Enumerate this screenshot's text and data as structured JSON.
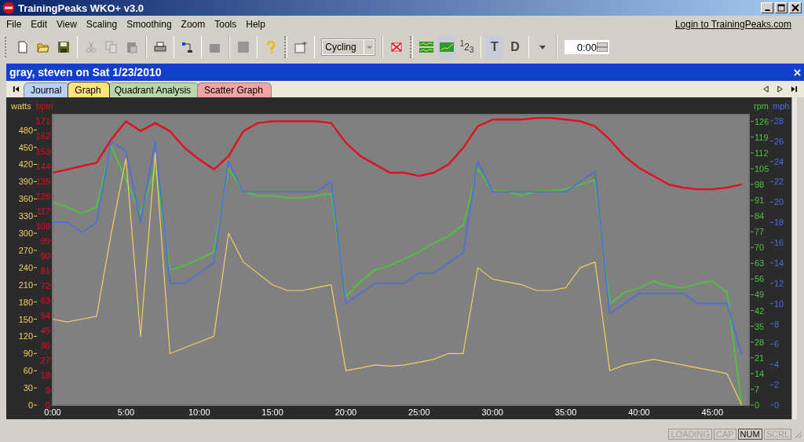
{
  "window": {
    "title": "TrainingPeaks WKO+ v3.0"
  },
  "menu": [
    "File",
    "Edit",
    "View",
    "Scaling",
    "Smoothing",
    "Zoom",
    "Tools",
    "Help"
  ],
  "login_link": "Login to TrainingPeaks.com",
  "toolbar": [
    {
      "kind": "new",
      "disabled": false
    },
    {
      "kind": "open",
      "disabled": false
    },
    {
      "kind": "save",
      "disabled": false
    },
    {
      "kind": "cut",
      "disabled": true
    },
    {
      "kind": "copy",
      "disabled": true
    },
    {
      "kind": "paste",
      "disabled": true
    },
    {
      "kind": "print",
      "disabled": false
    },
    {
      "kind": "connect",
      "disabled": false
    },
    {
      "kind": "device",
      "disabled": true
    },
    {
      "kind": "stop",
      "disabled": true
    },
    {
      "kind": "help",
      "disabled": false
    },
    {
      "kind": "window",
      "disabled": false
    }
  ],
  "sport_select": {
    "value": "Cycling"
  },
  "view_toggles": [
    {
      "kind": "stacked",
      "selected": false
    },
    {
      "kind": "overlay",
      "selected": true
    },
    {
      "kind": "text",
      "label": "$^{1}$2$_{3}$",
      "selected": false
    },
    {
      "kind": "text",
      "label": "T",
      "selected": true
    },
    {
      "kind": "text",
      "label": "D",
      "selected": false
    }
  ],
  "time_field": {
    "value": "0:00"
  },
  "document": {
    "title": "gray, steven on Sat 1/23/2010",
    "tabs": [
      {
        "label": "Journal",
        "color": "#b9d1f0",
        "selected": false
      },
      {
        "label": "Graph",
        "color": "#ffe27a",
        "selected": true
      },
      {
        "label": "Quadrant Analysis",
        "color": "#b9d6a9",
        "selected": false
      },
      {
        "label": "Scatter Graph",
        "color": "#f2a3a3",
        "selected": false
      }
    ],
    "charts": [
      {
        "chart_data": {
          "type": "line",
          "xlim": [
            0,
            47.5
          ],
          "ylim": [
            0,
            507
          ],
          "x": [
            0,
            1,
            2,
            3,
            4,
            5,
            6,
            7,
            8,
            9,
            10,
            11,
            12,
            13,
            14,
            15,
            16,
            17,
            18,
            19,
            20,
            21,
            22,
            23,
            24,
            25,
            26,
            27,
            28,
            29,
            30,
            31,
            32,
            33,
            34,
            35,
            36,
            37,
            38,
            39,
            40,
            41,
            42,
            43,
            44,
            45,
            46,
            47
          ],
          "xticks": [
            {
              "value": 0,
              "label": "0:00"
            },
            {
              "value": 5,
              "label": "5:00"
            },
            {
              "value": 10,
              "label": "10:00"
            },
            {
              "value": 15,
              "label": "15:00"
            },
            {
              "value": 20,
              "label": "20:00"
            },
            {
              "value": 25,
              "label": "25:00"
            },
            {
              "value": 30,
              "label": "30:00"
            },
            {
              "value": 35,
              "label": "35:00"
            },
            {
              "value": 40,
              "label": "40:00"
            },
            {
              "value": 45,
              "label": "45:00"
            }
          ],
          "yticks": [
            0,
            30,
            60,
            90,
            120,
            150,
            180,
            210,
            240,
            270,
            300,
            330,
            360,
            390,
            420,
            450,
            480
          ],
          "series": [
            {
              "name": "watts",
              "color": "#f0d060",
              "values": [
                150,
                145,
                150,
                155,
                300,
                430,
                120,
                440,
                90,
                100,
                110,
                120,
                300,
                250,
                230,
                210,
                200,
                200,
                205,
                210,
                60,
                65,
                70,
                68,
                70,
                75,
                80,
                90,
                90,
                240,
                220,
                215,
                210,
                200,
                200,
                205,
                240,
                250,
                60,
                70,
                75,
                80,
                75,
                70,
                65,
                60,
                55,
                0
              ]
            }
          ]
        }
      },
      {
        "chart_data": {
          "type": "line",
          "xlim": [
            0,
            47.5
          ],
          "ylim": [
            0,
            175
          ],
          "x": [
            0,
            1,
            2,
            3,
            4,
            5,
            6,
            7,
            8,
            9,
            10,
            11,
            12,
            13,
            14,
            15,
            16,
            17,
            18,
            19,
            20,
            21,
            22,
            23,
            24,
            25,
            26,
            27,
            28,
            29,
            30,
            31,
            32,
            33,
            34,
            35,
            36,
            37,
            38,
            39,
            40,
            41,
            42,
            43,
            44,
            45,
            46,
            47
          ],
          "yticks": [
            0,
            9,
            18,
            27,
            36,
            45,
            54,
            63,
            72,
            81,
            90,
            99,
            108,
            117,
            126,
            135,
            144,
            153,
            162,
            171
          ],
          "series": [
            {
              "name": "bpm",
              "color": "#e01020",
              "values": [
                140,
                142,
                144,
                146,
                160,
                171,
                165,
                170,
                165,
                155,
                148,
                142,
                150,
                165,
                170,
                171,
                171,
                171,
                171,
                170,
                158,
                150,
                145,
                140,
                140,
                138,
                140,
                145,
                155,
                168,
                172,
                172,
                172,
                173,
                173,
                172,
                171,
                168,
                160,
                150,
                143,
                138,
                133,
                131,
                130,
                130,
                131,
                133
              ]
            }
          ]
        }
      },
      {
        "chart_data": {
          "type": "line",
          "xlim": [
            0,
            47.5
          ],
          "ylim": [
            0,
            129
          ],
          "x": [
            0,
            1,
            2,
            3,
            4,
            5,
            6,
            7,
            8,
            9,
            10,
            11,
            12,
            13,
            14,
            15,
            16,
            17,
            18,
            19,
            20,
            21,
            22,
            23,
            24,
            25,
            26,
            27,
            28,
            29,
            30,
            31,
            32,
            33,
            34,
            35,
            36,
            37,
            38,
            39,
            40,
            41,
            42,
            43,
            44,
            45,
            46,
            47
          ],
          "yticks": [
            0,
            7,
            14,
            21,
            28,
            35,
            42,
            49,
            56,
            63,
            70,
            77,
            84,
            91,
            98,
            105,
            112,
            119,
            126
          ],
          "series": [
            {
              "name": "rpm",
              "color": "#50c040",
              "values": [
                90,
                88,
                85,
                88,
                115,
                100,
                85,
                105,
                60,
                62,
                65,
                68,
                105,
                95,
                93,
                93,
                92,
                92,
                93,
                94,
                48,
                55,
                60,
                62,
                65,
                68,
                72,
                75,
                80,
                105,
                95,
                95,
                93,
                95,
                95,
                96,
                98,
                100,
                45,
                50,
                52,
                55,
                53,
                52,
                54,
                55,
                50,
                0
              ]
            }
          ]
        }
      },
      {
        "chart_data": {
          "type": "line",
          "xlim": [
            0,
            47.5
          ],
          "ylim": [
            0,
            28.6
          ],
          "x": [
            0,
            1,
            2,
            3,
            4,
            5,
            6,
            7,
            8,
            9,
            10,
            11,
            12,
            13,
            14,
            15,
            16,
            17,
            18,
            19,
            20,
            21,
            22,
            23,
            24,
            25,
            26,
            27,
            28,
            29,
            30,
            31,
            32,
            33,
            34,
            35,
            36,
            37,
            38,
            39,
            40,
            41,
            42,
            43,
            44,
            45,
            46,
            47
          ],
          "yticks": [
            0,
            2,
            4,
            6,
            8,
            10,
            12,
            14,
            16,
            18,
            20,
            22,
            24,
            26,
            28
          ],
          "series": [
            {
              "name": "mph",
              "color": "#4a6ee0",
              "values": [
                18,
                18,
                17,
                18,
                26,
                25,
                18,
                26,
                12,
                12,
                13,
                14,
                24,
                21,
                21,
                21,
                21,
                21,
                21,
                22,
                10,
                11,
                12,
                12,
                12,
                13,
                13,
                14,
                15,
                24,
                21,
                21,
                21,
                21,
                21,
                21,
                22,
                23,
                9,
                10,
                11,
                11,
                11,
                11,
                10,
                10,
                10,
                5
              ]
            }
          ]
        }
      }
    ]
  },
  "status_bar": [
    {
      "label": "LOADING",
      "on": false
    },
    {
      "label": "CAP",
      "on": false
    },
    {
      "label": "NUM",
      "on": true
    },
    {
      "label": "SCRL",
      "on": false
    }
  ]
}
